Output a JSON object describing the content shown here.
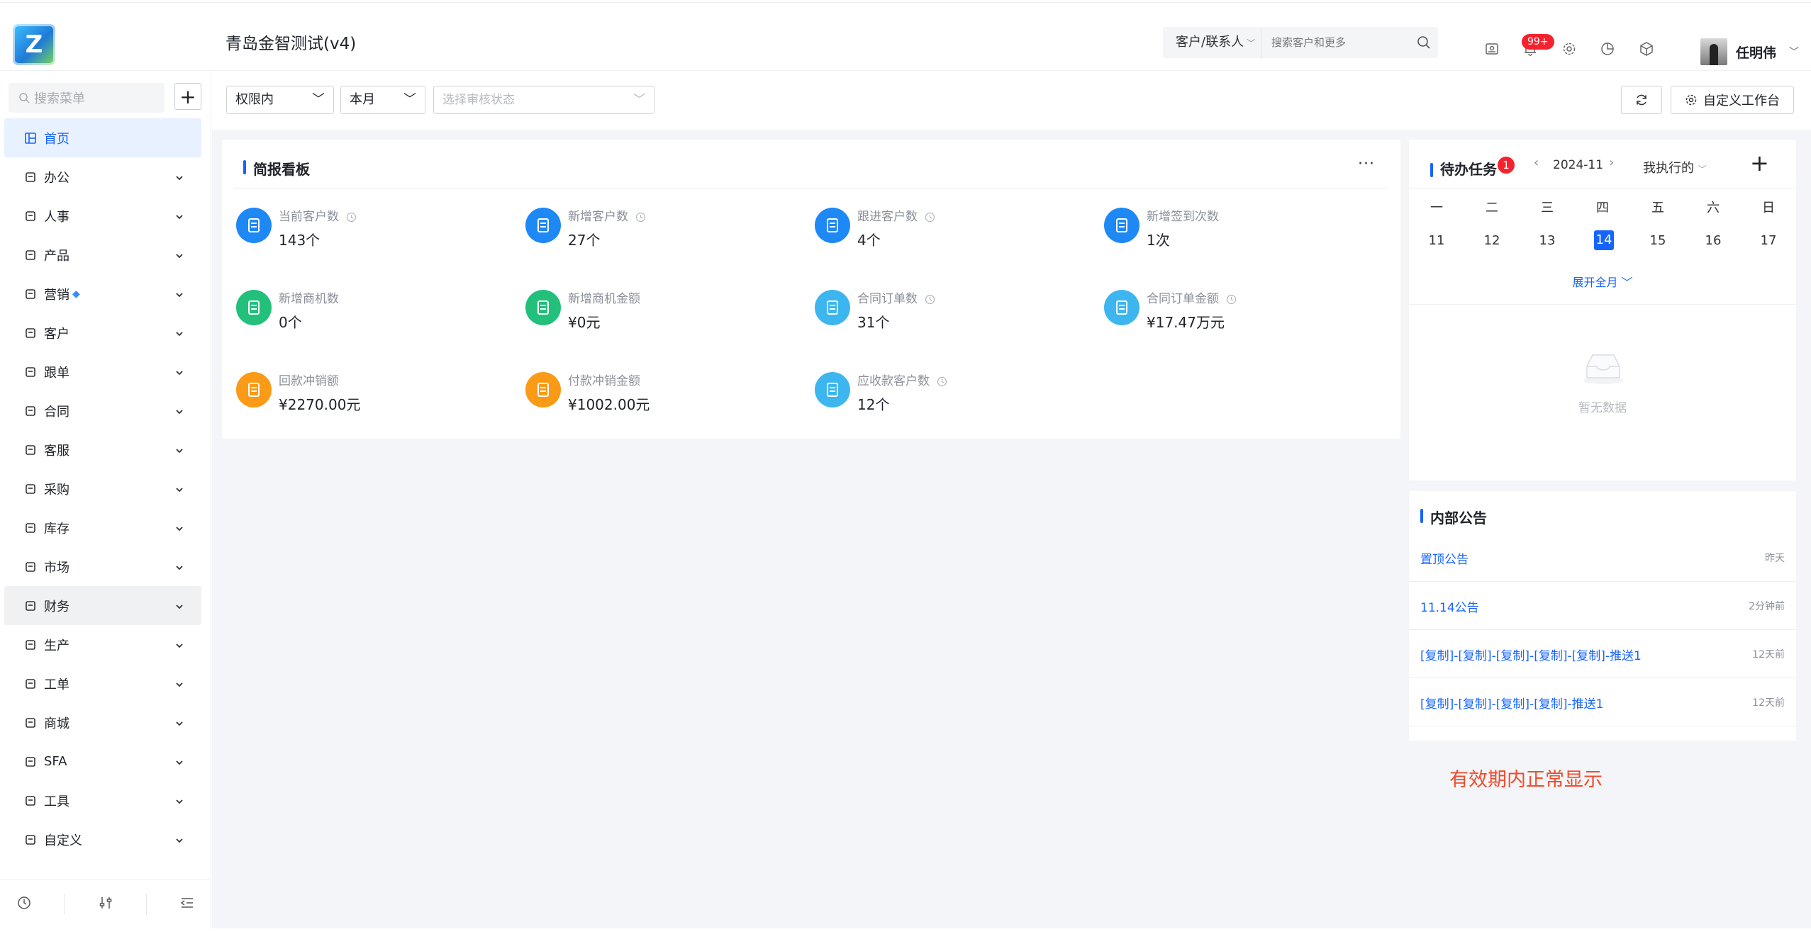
{
  "header": {
    "app_title": "青岛金智测试(v4)",
    "search_type": "客户/联系人",
    "search_placeholder": "搜索客户和更多",
    "notify_badge": "99+",
    "user_name": "任明伟"
  },
  "sidebar": {
    "search_placeholder": "搜索菜单",
    "items": [
      {
        "label": "首页",
        "icon": "home-icon"
      },
      {
        "label": "办公",
        "icon": "office-icon"
      },
      {
        "label": "人事",
        "icon": "hr-icon"
      },
      {
        "label": "产品",
        "icon": "product-icon"
      },
      {
        "label": "营销",
        "icon": "marketing-icon"
      },
      {
        "label": "客户",
        "icon": "customer-icon"
      },
      {
        "label": "跟单",
        "icon": "follow-icon"
      },
      {
        "label": "合同",
        "icon": "contract-icon"
      },
      {
        "label": "客服",
        "icon": "service-icon"
      },
      {
        "label": "采购",
        "icon": "purchase-icon"
      },
      {
        "label": "库存",
        "icon": "inventory-icon"
      },
      {
        "label": "市场",
        "icon": "market-icon"
      },
      {
        "label": "财务",
        "icon": "finance-icon"
      },
      {
        "label": "生产",
        "icon": "production-icon"
      },
      {
        "label": "工单",
        "icon": "workorder-icon"
      },
      {
        "label": "商城",
        "icon": "mall-icon"
      },
      {
        "label": "SFA",
        "icon": "sfa-icon"
      },
      {
        "label": "工具",
        "icon": "tools-icon"
      },
      {
        "label": "自定义",
        "icon": "custom-icon"
      }
    ]
  },
  "filters": {
    "scope": "权限内",
    "period": "本月",
    "status_placeholder": "选择审核状态",
    "customize_label": "自定义工作台"
  },
  "brief": {
    "title": "简报看板",
    "kpis": [
      {
        "label": "当前客户数",
        "value": "143个",
        "color": "#1e88f5"
      },
      {
        "label": "新增客户数",
        "value": "27个",
        "color": "#1e88f5"
      },
      {
        "label": "跟进客户数",
        "value": "4个",
        "color": "#1e88f5"
      },
      {
        "label": "新增签到次数",
        "value": "1次",
        "color": "#1e88f5"
      },
      {
        "label": "新增商机数",
        "value": "0个",
        "color": "#22c07a"
      },
      {
        "label": "新增商机金额",
        "value": "¥0元",
        "color": "#22c07a"
      },
      {
        "label": "合同订单数",
        "value": "31个",
        "color": "#3db6f0"
      },
      {
        "label": "合同订单金额",
        "value": "¥17.47万元",
        "color": "#3db6f0"
      },
      {
        "label": "回款冲销额",
        "value": "¥2270.00元",
        "color": "#fa9a16"
      },
      {
        "label": "付款冲销金额",
        "value": "¥1002.00元",
        "color": "#fa9a16"
      },
      {
        "label": "应收款客户数",
        "value": "12个",
        "color": "#3db6f0"
      }
    ]
  },
  "todo": {
    "title": "待办任务",
    "badge": "1",
    "month": "2024-11",
    "filter": "我执行的",
    "weekdays": [
      "一",
      "二",
      "三",
      "四",
      "五",
      "六",
      "日"
    ],
    "dates": [
      "11",
      "12",
      "13",
      "14",
      "15",
      "16",
      "17"
    ],
    "today_index": 3,
    "dot_index": 4,
    "expand_label": "展开全月",
    "empty_text": "暂无数据"
  },
  "notices": {
    "title": "内部公告",
    "items": [
      {
        "title": "置顶公告",
        "time": "昨天"
      },
      {
        "title": "11.14公告",
        "time": "2分钟前"
      },
      {
        "title": "[复制]-[复制]-[复制]-[复制]-[复制]-推送1",
        "time": "12天前"
      },
      {
        "title": "[复制]-[复制]-[复制]-[复制]-推送1",
        "time": "12天前"
      }
    ]
  },
  "annotation": "有效期内正常显示",
  "colors": {
    "accent": "#1664ff",
    "badge": "#f5222d",
    "note": "#f04b2b"
  }
}
